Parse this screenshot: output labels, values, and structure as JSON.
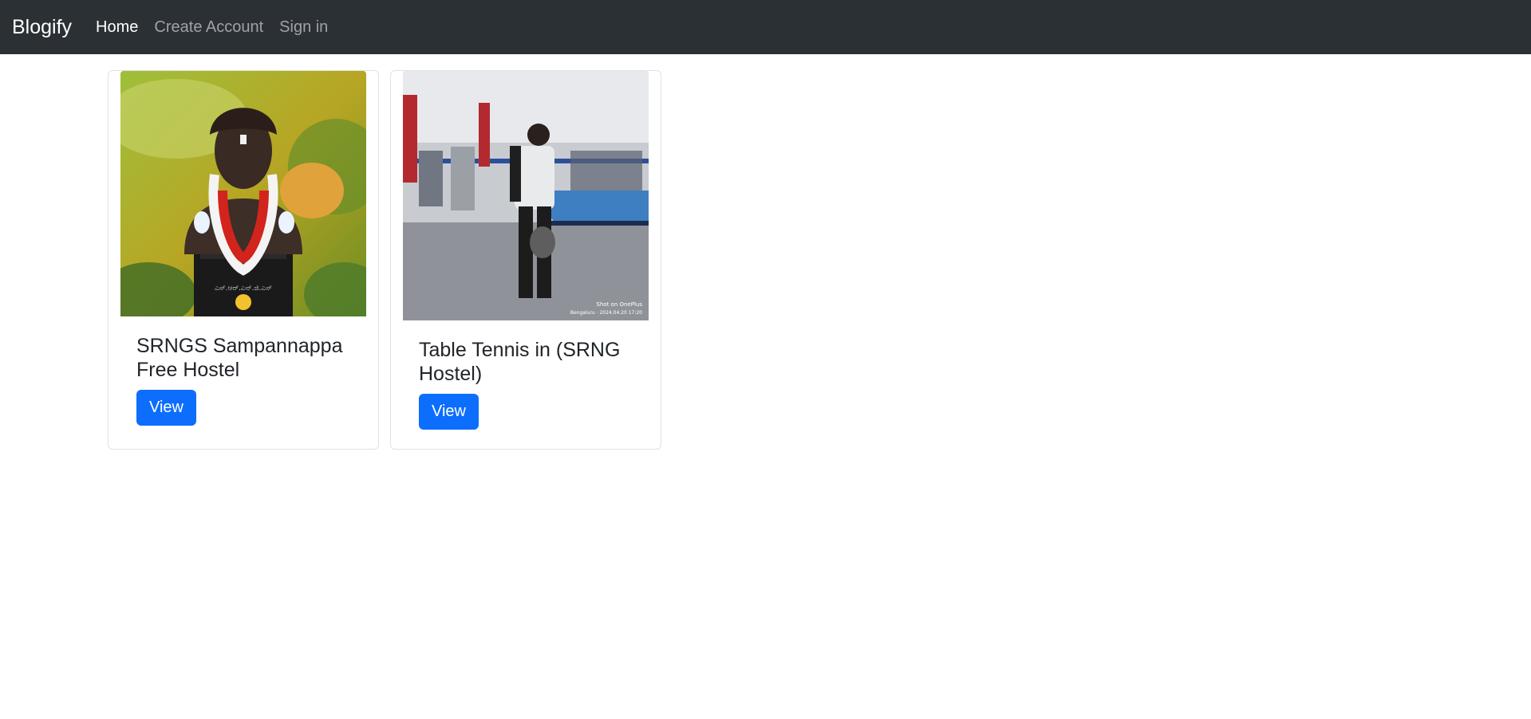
{
  "nav": {
    "brand": "Blogify",
    "links": [
      {
        "label": "Home"
      },
      {
        "label": "Create Account"
      },
      {
        "label": "Sign in"
      }
    ]
  },
  "posts": [
    {
      "title": "SRNGS Sampannappa Free Hostel",
      "button": "View",
      "image": "statue-photo"
    },
    {
      "title": "Table Tennis in (SRNG Hostel)",
      "button": "View",
      "image": "table-tennis-photo",
      "image_caption": [
        "Shot on OnePlus",
        "Bengaluru · 2024.04.20 17:20"
      ]
    }
  ],
  "colors": {
    "navbar": "#2b3035",
    "primary": "#0d6efd"
  }
}
